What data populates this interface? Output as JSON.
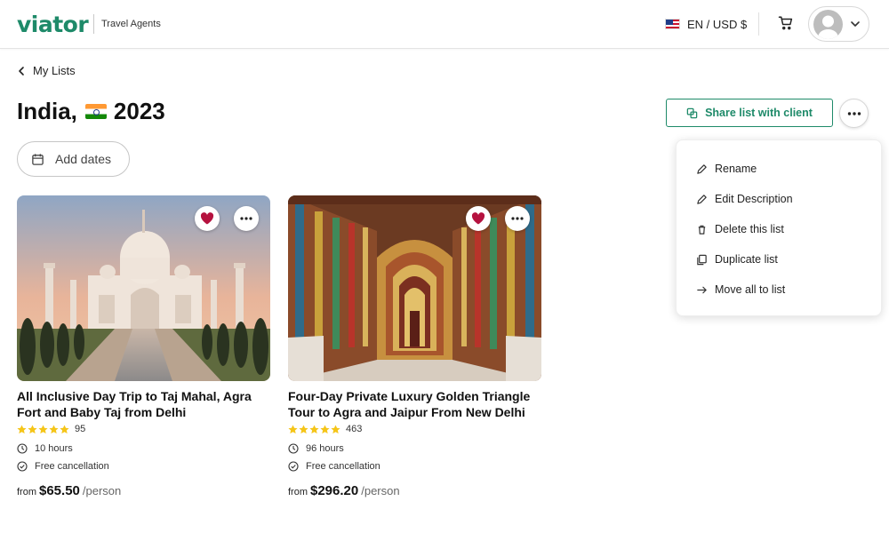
{
  "header": {
    "logo_text": "viator",
    "logo_subtitle": "Travel Agents",
    "locale_label": "EN / USD $"
  },
  "breadcrumb": {
    "back_label": "My Lists"
  },
  "list": {
    "title_prefix": "India,",
    "title_year": "2023",
    "add_dates_label": "Add dates",
    "share_label": "Share list with client"
  },
  "menu": {
    "items": [
      {
        "label": "Rename",
        "icon": "pencil-icon"
      },
      {
        "label": "Edit Description",
        "icon": "pencil-icon"
      },
      {
        "label": "Delete this list",
        "icon": "trash-icon"
      },
      {
        "label": "Duplicate list",
        "icon": "duplicate-icon"
      },
      {
        "label": "Move all to list",
        "icon": "arrow-right-icon"
      }
    ]
  },
  "cards": [
    {
      "title_line1": "All Inclusive Day Trip to Taj Mahal, Agra",
      "title_line2": "Fort and Baby Taj from Delhi",
      "rating_stars": 5,
      "review_count": "95",
      "duration": "10 hours",
      "cancellation": "Free cancellation",
      "price_prefix": "from",
      "price": "$65.50",
      "price_unit": "/person",
      "image": "taj-mahal-photo"
    },
    {
      "title_line1": "Four-Day Private Luxury Golden Triangle",
      "title_line2": "Tour to Agra and Jaipur From New Delhi",
      "rating_stars": 5,
      "review_count": "463",
      "duration": "96 hours",
      "cancellation": "Free cancellation",
      "price_prefix": "from",
      "price": "$296.20",
      "price_unit": "/person",
      "image": "jaipur-palace-corridor-photo"
    }
  ],
  "colors": {
    "brand": "#1e8a69",
    "heart": "#b5123f",
    "star": "#f5c518"
  }
}
